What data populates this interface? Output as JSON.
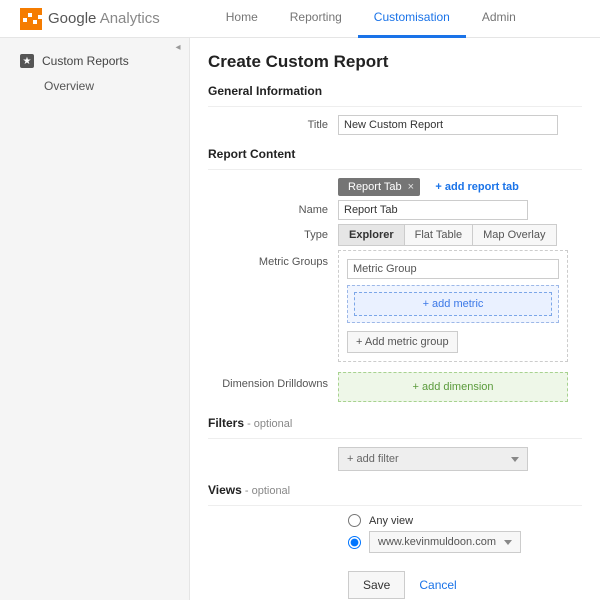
{
  "brand": {
    "name_a": "Google",
    "name_b": " Analytics"
  },
  "topnav": {
    "items": [
      "Home",
      "Reporting",
      "Customisation",
      "Admin"
    ],
    "active_index": 2
  },
  "sidebar": {
    "main": "Custom Reports",
    "sub": "Overview"
  },
  "page": {
    "title": "Create Custom Report",
    "sec_general": "General Information",
    "title_label": "Title",
    "title_value": "New Custom Report",
    "sec_content": "Report Content",
    "report_tab_pill": "Report Tab",
    "add_tab": "+ add report tab",
    "name_label": "Name",
    "name_value": "Report Tab",
    "type_label": "Type",
    "type_options": [
      "Explorer",
      "Flat Table",
      "Map Overlay"
    ],
    "type_active_index": 0,
    "metric_groups_label": "Metric Groups",
    "metric_group_name": "Metric Group",
    "add_metric": "+ add metric",
    "add_metric_group": "+ Add metric group",
    "dim_label": "Dimension Drilldowns",
    "add_dimension": "+ add dimension",
    "sec_filters": "Filters",
    "optional": " - optional",
    "add_filter": "+ add filter",
    "sec_views": "Views",
    "any_view": "Any view",
    "selected_view": "www.kevinmuldoon.com",
    "view_radio_selected": 1,
    "save": "Save",
    "cancel": "Cancel"
  }
}
